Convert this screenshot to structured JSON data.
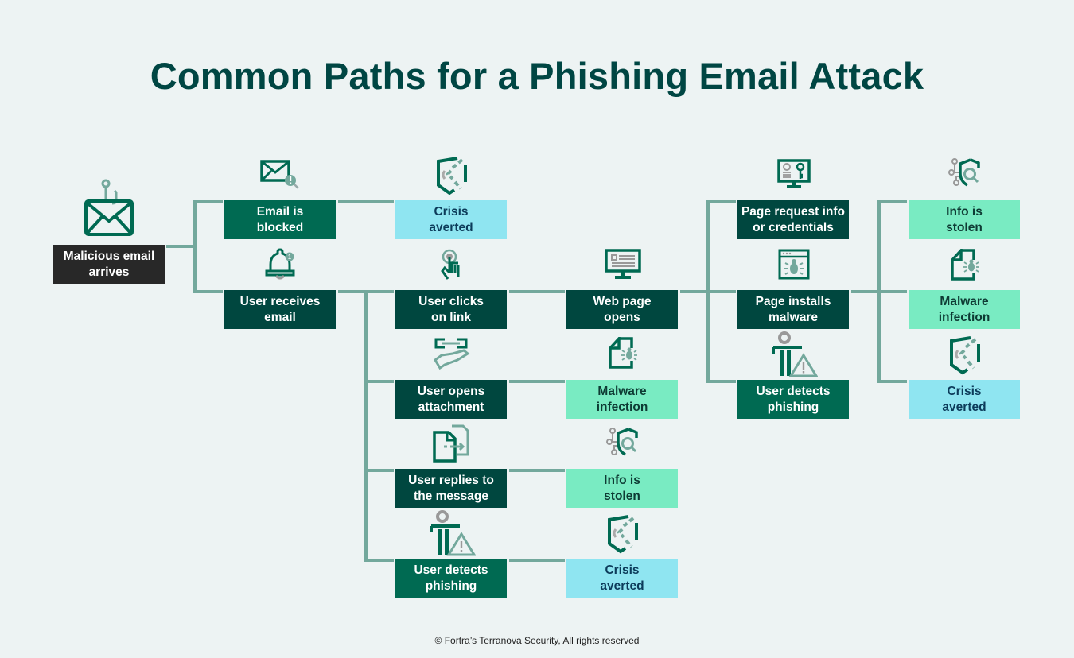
{
  "title": "Common Paths for a Phishing Email Attack",
  "footer": "© Fortra’s Terranova Security, All rights reserved",
  "colors": {
    "background": "#edf3f3",
    "title": "#004643",
    "connector": "#73a89c",
    "action_dark": "#00473f",
    "action_mid": "#006a52",
    "start": "#282828",
    "outcome_bad": "#79ebc2",
    "outcome_safe": "#8fe5f1"
  },
  "nodes": {
    "start": {
      "label": "Malicious email\narrives",
      "icon": "phishing-hook-envelope-icon"
    },
    "email_blocked": {
      "label": "Email is\nblocked",
      "icon": "envelope-alert-search-icon"
    },
    "crisis_averted_1": {
      "label": "Crisis\naverted",
      "icon": "shield-signal-icon"
    },
    "user_receives": {
      "label": "User receives\nemail",
      "icon": "notification-bell-icon"
    },
    "user_clicks": {
      "label": "User clicks\non link",
      "icon": "finger-tap-icon"
    },
    "web_page_opens": {
      "label": "Web page\nopens",
      "icon": "monitor-webpage-icon"
    },
    "page_request": {
      "label": "Page request info\nor credentials",
      "icon": "monitor-credentials-key-icon"
    },
    "page_installs": {
      "label": "Page installs\nmalware",
      "icon": "browser-bug-icon"
    },
    "user_detects_2": {
      "label": "User detects\nphishing",
      "icon": "person-warning-icon"
    },
    "info_stolen_2": {
      "label": "Info is\nstolen",
      "icon": "shield-network-search-icon"
    },
    "malware_infection_2": {
      "label": "Malware\ninfection",
      "icon": "file-bug-icon"
    },
    "crisis_averted_3": {
      "label": "Crisis\naverted",
      "icon": "shield-signal-icon"
    },
    "user_opens": {
      "label": "User opens\nattachment",
      "icon": "link-handshake-icon"
    },
    "malware_infection_1": {
      "label": "Malware\ninfection",
      "icon": "file-bug-icon"
    },
    "user_replies": {
      "label": "User replies to\nthe message",
      "icon": "document-forward-icon"
    },
    "info_stolen_1": {
      "label": "Info is\nstolen",
      "icon": "shield-network-search-icon"
    },
    "user_detects_1": {
      "label": "User detects\nphishing",
      "icon": "person-warning-icon"
    },
    "crisis_averted_2": {
      "label": "Crisis\naverted",
      "icon": "shield-signal-icon"
    }
  },
  "edges": [
    [
      "start",
      "email_blocked"
    ],
    [
      "start",
      "user_receives"
    ],
    [
      "email_blocked",
      "crisis_averted_1"
    ],
    [
      "user_receives",
      "user_clicks"
    ],
    [
      "user_receives",
      "user_opens"
    ],
    [
      "user_receives",
      "user_replies"
    ],
    [
      "user_receives",
      "user_detects_1"
    ],
    [
      "user_clicks",
      "web_page_opens"
    ],
    [
      "user_opens",
      "malware_infection_1"
    ],
    [
      "user_replies",
      "info_stolen_1"
    ],
    [
      "user_detects_1",
      "crisis_averted_2"
    ],
    [
      "web_page_opens",
      "page_request"
    ],
    [
      "web_page_opens",
      "page_installs"
    ],
    [
      "web_page_opens",
      "user_detects_2"
    ],
    [
      "page_installs",
      "info_stolen_2"
    ],
    [
      "page_installs",
      "malware_infection_2"
    ],
    [
      "page_installs",
      "crisis_averted_3"
    ]
  ]
}
